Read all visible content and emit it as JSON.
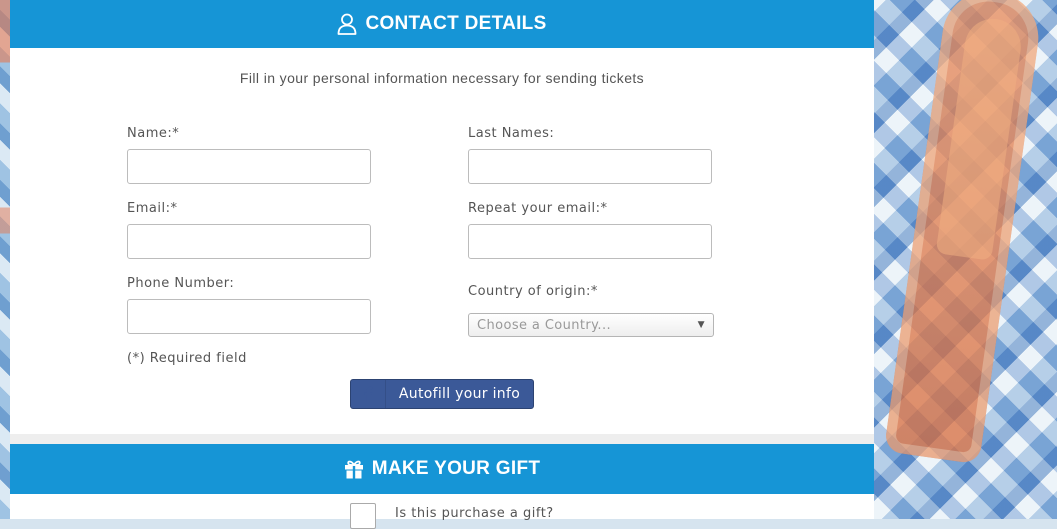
{
  "contact": {
    "header_title": "CONTACT DETAILS",
    "subtitle": "Fill in your personal information necessary for sending tickets",
    "name_label": "Name:*",
    "name_value": "",
    "last_names_label": "Last Names:",
    "last_names_value": "",
    "email_label": "Email:*",
    "email_value": "",
    "repeat_email_label": "Repeat your email:*",
    "repeat_email_value": "",
    "phone_label": "Phone Number:",
    "phone_value": "",
    "country_label": "Country of origin:*",
    "country_placeholder": "Choose a Country...",
    "required_note": "(*) Required field",
    "autofill_label": "Autofill your info"
  },
  "gift": {
    "header_title": "MAKE YOUR GIFT",
    "question_label": "Is this purchase a gift?",
    "checked": false
  },
  "colors": {
    "header_bg": "#1695d6",
    "autofill_bg": "#3b5998"
  },
  "icons": {
    "contact": "user-icon",
    "gift": "gift-icon",
    "autofill": "facebook-icon",
    "select": "caret-down-icon"
  }
}
